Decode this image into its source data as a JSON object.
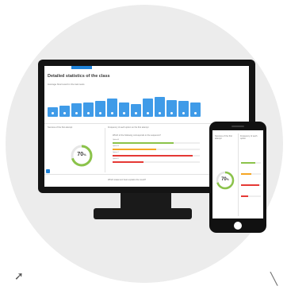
{
  "dashboard": {
    "title": "Detailed statistics of the class",
    "subtitle": "Average final result in the last tests",
    "bar_values": [
      40,
      48,
      56,
      60,
      68,
      76,
      60,
      52,
      76,
      84,
      70,
      66,
      60
    ],
    "bar_labels": [
      "",
      "",
      "",
      "",
      "",
      "",
      "",
      "",
      "",
      "",
      "",
      "",
      ""
    ],
    "success_panel_title": "Success of the first attempt",
    "frequency_panel_title": "Frequency of each option on the first attempt",
    "success_percent": "70",
    "success_percent_suffix": "%",
    "question_1": "Which of the following corresponds to the sequence?",
    "options": [
      {
        "text": "Option A",
        "fraction": 0.7,
        "color": "#8bc34a"
      },
      {
        "text": "Option B",
        "fraction": 0.5,
        "color": "#f5a623"
      },
      {
        "text": "Option C",
        "fraction": 0.92,
        "color": "#e53935"
      },
      {
        "text": "Option D",
        "fraction": 0.35,
        "color": "#e53935"
      }
    ],
    "question_2": "Which statement best explains the result?"
  },
  "phone": {
    "card_1": "Success of the first attempt",
    "card_2": "Frequency of each option",
    "percent": "70",
    "percent_suffix": "%"
  },
  "colors": {
    "accent": "#1f82d8",
    "bar": "#3f9be8",
    "ring_green": "#8bc34a",
    "ring_dark": "#2e7d32"
  }
}
